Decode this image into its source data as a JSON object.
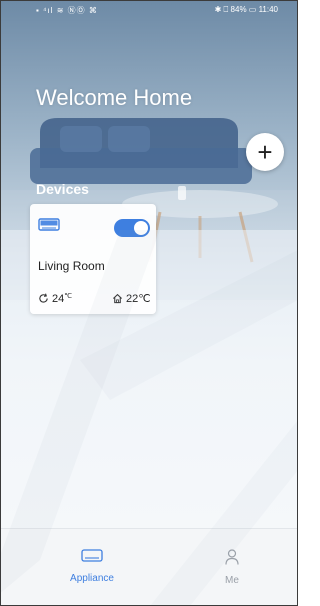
{
  "status_bar": {
    "left_icons": "▪ ⁴ıl ≋ ⓃⓄ ⌘",
    "right_text": "✱ ⎕ 84% ▭ 11:40"
  },
  "header": {
    "title": "Welcome Home"
  },
  "add_button": {
    "icon": "plus-icon",
    "label": "+"
  },
  "devices": {
    "title": "Devices",
    "cards": [
      {
        "name": "Living Room",
        "power_on": true,
        "indoor_temp": "24",
        "indoor_unit": "℃",
        "outdoor_temp": "22℃"
      }
    ]
  },
  "bottom_nav": {
    "items": [
      {
        "label": "Appliance",
        "icon": "appliance-icon",
        "active": true
      },
      {
        "label": "Me",
        "icon": "person-icon",
        "active": false
      }
    ]
  },
  "colors": {
    "accent": "#3e7fe0",
    "inactive": "#9aa0a8"
  }
}
